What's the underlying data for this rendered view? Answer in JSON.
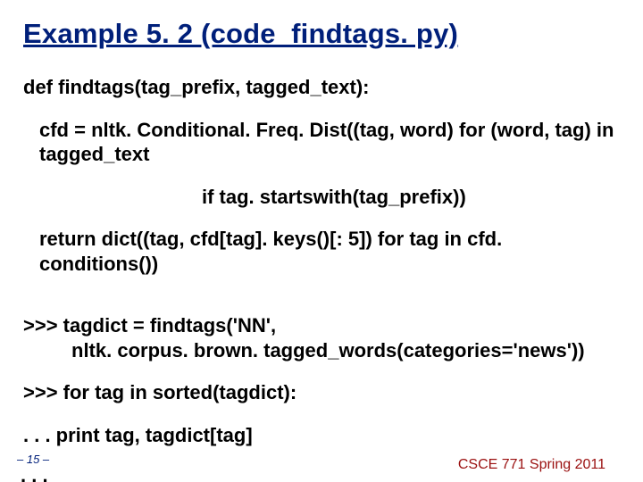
{
  "slide": {
    "title": "Example 5. 2 (code_findtags. py)",
    "lines": {
      "def": "def findtags(tag_prefix, tagged_text):",
      "cfd": " cfd = nltk. Conditional. Freq. Dist((tag, word) for (word, tag) in tagged_text",
      "ifline": "if tag. startswith(tag_prefix))",
      "ret": " return dict((tag, cfd[tag]. keys()[: 5]) for tag in cfd. conditions())",
      "tagdict1": ">>> tagdict = findtags('NN',",
      "tagdict2": "nltk. corpus. brown. tagged_words(categories='news'))",
      "forline": ">>> for tag in sorted(tagdict):",
      "printline": ". . . print tag, tagdict[tag]",
      "dots": ". . ."
    },
    "footer": {
      "page": "– 15 –",
      "course": "CSCE 771 Spring 2011"
    }
  }
}
